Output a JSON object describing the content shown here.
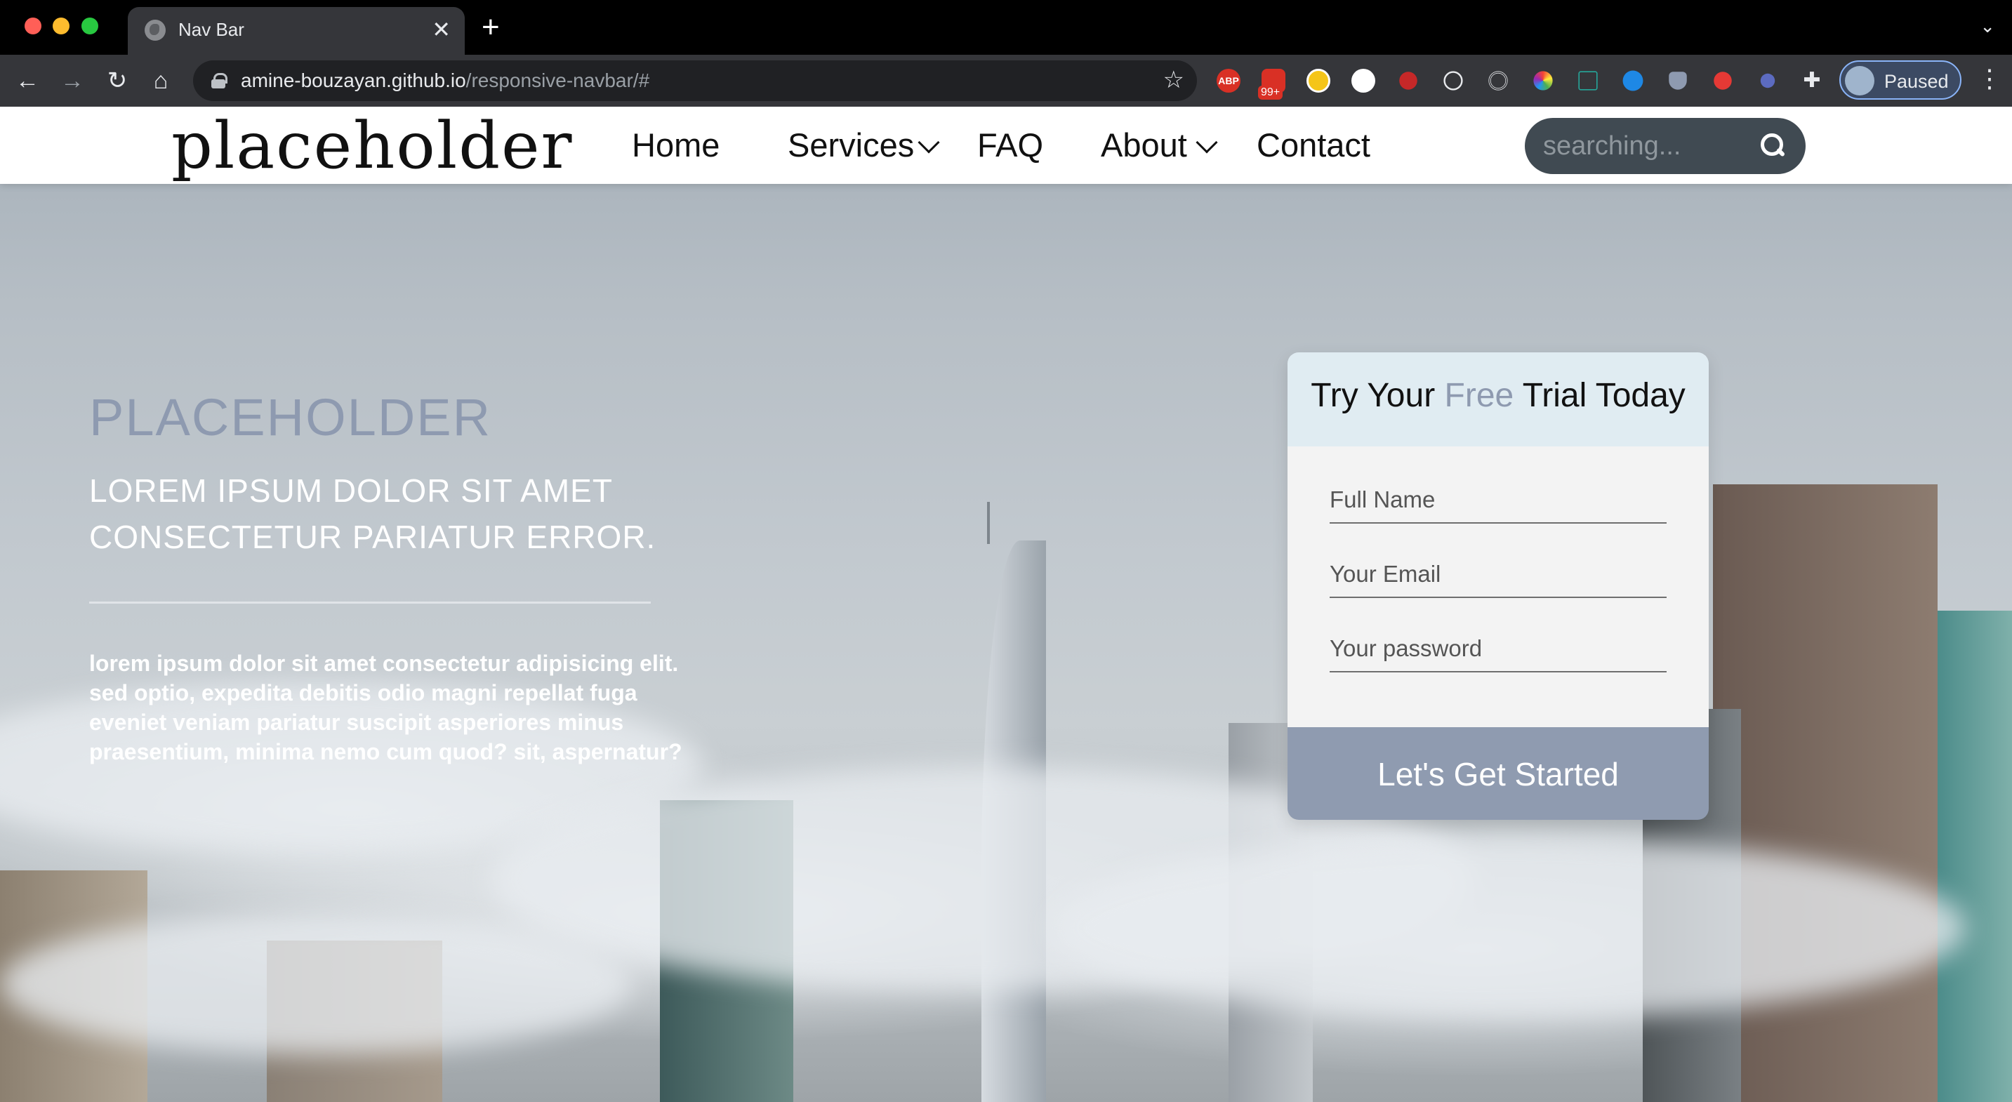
{
  "browser": {
    "tab_title": "Nav Bar",
    "url_host": "amine-bouzayan.github.io",
    "url_path": "/responsive-navbar/#",
    "profile_label": "Paused",
    "extension_badge": "99+",
    "abp_label": "ABP"
  },
  "navbar": {
    "logo": "placeholder",
    "items": [
      {
        "label": "Home"
      },
      {
        "label": "Services"
      },
      {
        "label": "FAQ"
      },
      {
        "label": "About"
      },
      {
        "label": "Contact"
      }
    ],
    "search_placeholder": "searching..."
  },
  "hero": {
    "title": "PLACEHOLDER",
    "subtitle": "LOREM IPSUM DOLOR SIT AMET CONSECTETUR PARIATUR ERROR.",
    "body": "lorem ipsum dolor sit amet consectetur adipisicing elit. sed optio, expedita debitis odio magni repellat fuga eveniet veniam pariatur suscipit asperiores minus praesentium, minima nemo cum quod? sit, aspernatur?"
  },
  "form": {
    "title_before": "Try Your ",
    "title_highlight": "Free",
    "title_after": " Trial Today",
    "name_placeholder": "Full Name",
    "email_placeholder": "Your Email",
    "password_placeholder": "Your password",
    "submit_label": "Let's Get Started"
  },
  "colors": {
    "accent": "#8e9ab0",
    "search_bg": "#404a52",
    "card_head_bg": "#e0ecf2"
  }
}
